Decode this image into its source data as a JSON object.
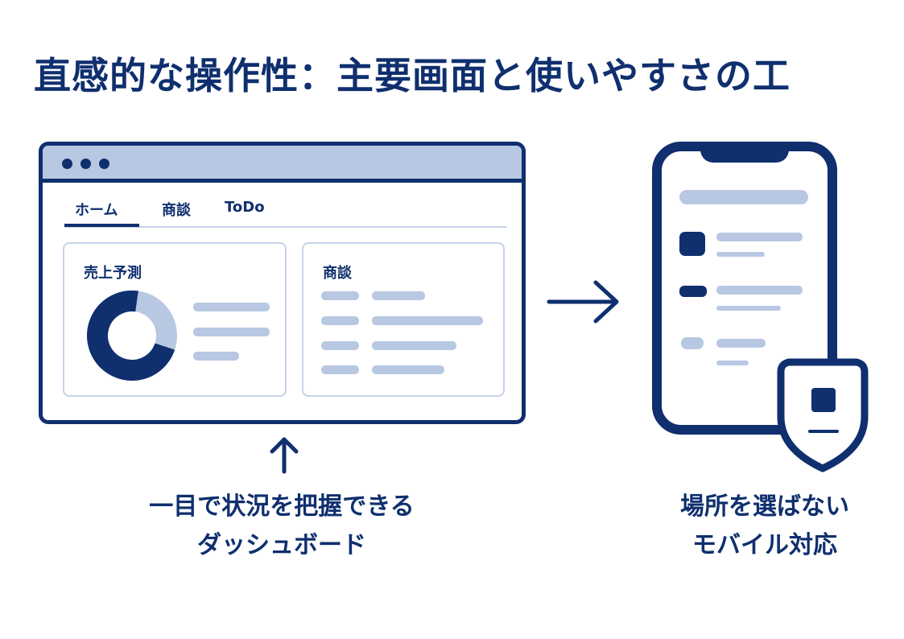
{
  "title": "直感的な操作性：主要画面と使いやすさの工",
  "dashboard": {
    "tabs": [
      "ホーム",
      "商談",
      "ToDo"
    ],
    "sales_card_title": "売上予測",
    "deals_card_title": "商談"
  },
  "captions": {
    "dashboard_line1": "一目で状況を把握できる",
    "dashboard_line2": "ダッシュボード",
    "mobile_line1": "場所を選ばない",
    "mobile_line2": "モバイル対応"
  },
  "colors": {
    "navy": "#0f2f6e",
    "light_blue": "#b8c8e3",
    "border_blue": "#c6d2e8"
  },
  "donut": {
    "filled_fraction": 0.72
  }
}
